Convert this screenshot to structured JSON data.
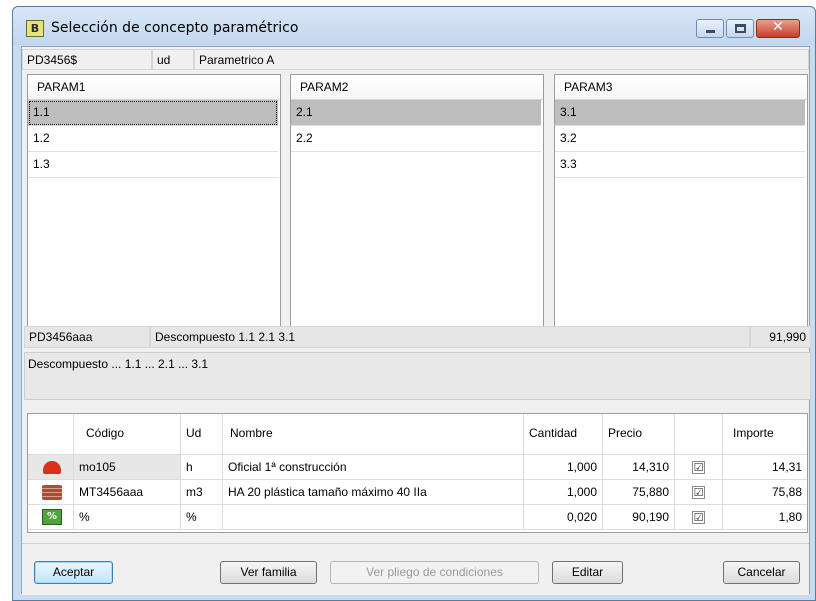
{
  "window": {
    "title": "Selección de concepto paramétrico",
    "title_icon": "parametric-app-icon",
    "controls": {
      "minimize": "minimize",
      "maximize": "maximize",
      "close": "✕"
    }
  },
  "concept": {
    "code": "PD3456$",
    "unit": "ud",
    "name": "Parametrico A"
  },
  "params": [
    {
      "header": "PARAM1",
      "options": [
        "1.1",
        "1.2",
        "1.3"
      ],
      "selected_index": 0
    },
    {
      "header": "PARAM2",
      "options": [
        "2.1",
        "2.2"
      ],
      "selected_index": 0
    },
    {
      "header": "PARAM3",
      "options": [
        "3.1",
        "3.2",
        "3.3"
      ],
      "selected_index": 0
    }
  ],
  "result": {
    "code": "PD3456aaa",
    "summary": "Descompuesto 1.1 2.1 3.1",
    "price": "91,990",
    "description": "Descompuesto ... 1.1 ... 2.1 ... 3.1"
  },
  "table": {
    "columns": [
      "",
      "Código",
      "Ud",
      "Nombre",
      "Cantidad",
      "Precio",
      "",
      "Importe"
    ],
    "rows": [
      {
        "icon": "helmet-icon",
        "code": "mo105",
        "unit": "h",
        "name": "Oficial 1ª construcción",
        "qty": "1,000",
        "price": "14,310",
        "checked": "☑",
        "amount": "14,31"
      },
      {
        "icon": "bricks-icon",
        "code": "MT3456aaa",
        "unit": "m3",
        "name": "HA 20 plástica tamaño máximo 40 IIa",
        "qty": "1,000",
        "price": "75,880",
        "checked": "☑",
        "amount": "75,88"
      },
      {
        "icon": "percent-icon",
        "icon_text": "%",
        "code": "%",
        "unit": "%",
        "name": "",
        "qty": "0,020",
        "price": "90,190",
        "checked": "☑",
        "amount": "1,80"
      }
    ]
  },
  "buttons": {
    "accept": "Aceptar",
    "family": "Ver familia",
    "conditions": "Ver pliego de condiciones",
    "edit": "Editar",
    "cancel": "Cancelar"
  },
  "colors": {
    "selection": "#bdbdbd",
    "title_bar": "#c9dbef",
    "close_button": "#c4402b"
  }
}
